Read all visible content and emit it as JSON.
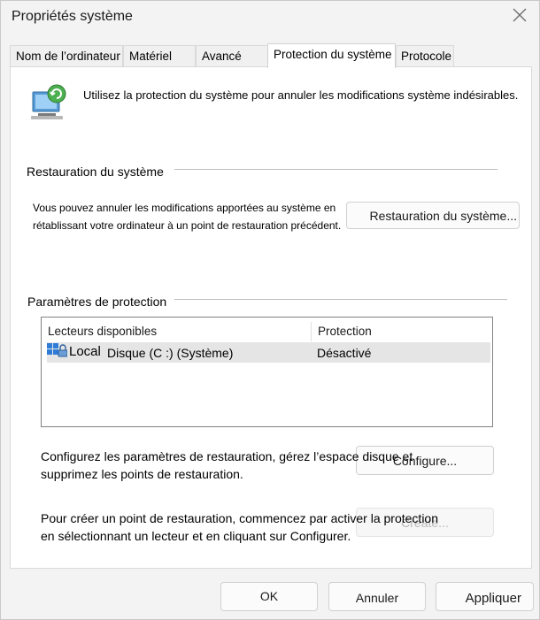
{
  "window": {
    "title": "Propriétés système",
    "close_icon": "close-icon"
  },
  "tabs": [
    {
      "label": "Nom de l’ordinateur"
    },
    {
      "label": "Matériel"
    },
    {
      "label": "Avancé"
    },
    {
      "label": "Protection du système",
      "active": true
    },
    {
      "label": "Protocole"
    }
  ],
  "intro": {
    "icon": "system-protection-icon",
    "text": "Utilisez la protection du système pour annuler les modifications système indésirables."
  },
  "restore": {
    "heading": "Restauration du système",
    "description_line1": "Vous pouvez annuler les modifications apportées au système en",
    "description_line2": "rétablissant votre ordinateur à un point de restauration précédent.",
    "button": "Restauration du système..."
  },
  "protection": {
    "heading": "Paramètres de protection",
    "columns": [
      "Lecteurs disponibles",
      "Protection"
    ],
    "drives": [
      {
        "icon": "drive-icon",
        "label_a": "Local",
        "label_b": "Disque (C :) (Système)",
        "protection": "Désactivé"
      }
    ],
    "configure_text_line1": "Configurez les paramètres de restauration, gérez l’espace disque et",
    "configure_text_line2": "supprimez les points de restauration.",
    "configure_button": "Configure...",
    "create_text_line1": "Pour créer un point de restauration, commencez par activer la protection",
    "create_text_line2": "en sélectionnant un lecteur et en cliquant sur Configurer.",
    "create_button": "Create..."
  },
  "footer": {
    "ok": "OK",
    "cancel": "Annuler",
    "apply": "Appliquer"
  },
  "colors": {
    "window_bg": "#f3f3f3",
    "panel_bg": "#ffffff",
    "selected_row": "#e5e5e5",
    "disabled_text": "#b8b8b8"
  }
}
